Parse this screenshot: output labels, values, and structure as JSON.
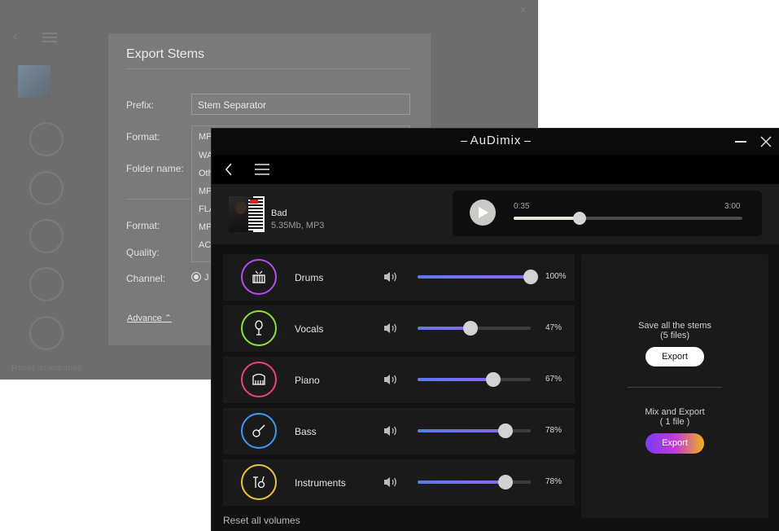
{
  "background_window": {
    "dialog": {
      "title": "Export Stems",
      "prefix_label": "Prefix:",
      "prefix_value": "Stem Separator",
      "format_label": "Format:",
      "folder_label": "Folder name:",
      "format2_label": "Format:",
      "quality_label": "Quality:",
      "channel_label": "Channel:",
      "radio_text": "J",
      "advance_link": "Advance",
      "format_options": [
        "MP",
        "WA",
        "Oth",
        "MP",
        "FLA",
        "MP",
        "AC"
      ]
    },
    "reset_text": "Reset all volumes"
  },
  "window": {
    "brand": "AuDimix",
    "minimize_icon": "minimize-icon",
    "close_icon": "close-icon"
  },
  "toolbar": {
    "back_icon": "chevron-left-icon",
    "menu_icon": "hamburger-menu-icon"
  },
  "song": {
    "title": "Bad",
    "meta": "5.35Mb, MP3"
  },
  "player": {
    "current_time": "0:35",
    "total_time": "3:00",
    "progress": 0.29
  },
  "stems": [
    {
      "name": "Drums",
      "volume": 100,
      "percent": "100%",
      "color": "#b44cf0",
      "icon": "drum-kit-icon"
    },
    {
      "name": "Vocals",
      "volume": 47,
      "percent": "47%",
      "color": "#8fe03a",
      "icon": "microphone-icon"
    },
    {
      "name": "Piano",
      "volume": 67,
      "percent": "67%",
      "color": "#f0407a",
      "icon": "piano-icon"
    },
    {
      "name": "Bass",
      "volume": 78,
      "percent": "78%",
      "color": "#3a9af0",
      "icon": "guitar-icon"
    },
    {
      "name": "Instruments",
      "volume": 78,
      "percent": "78%",
      "color": "#f0c23a",
      "icon": "instruments-icon"
    }
  ],
  "reset_label": "Reset all volumes",
  "export_panel": {
    "save_all_line1": "Save all the stems",
    "save_all_line2": "(5 files)",
    "export_label": "Export",
    "mix_line1": "Mix and Export",
    "mix_line2": "( 1 file )",
    "mix_export_label": "Export"
  }
}
